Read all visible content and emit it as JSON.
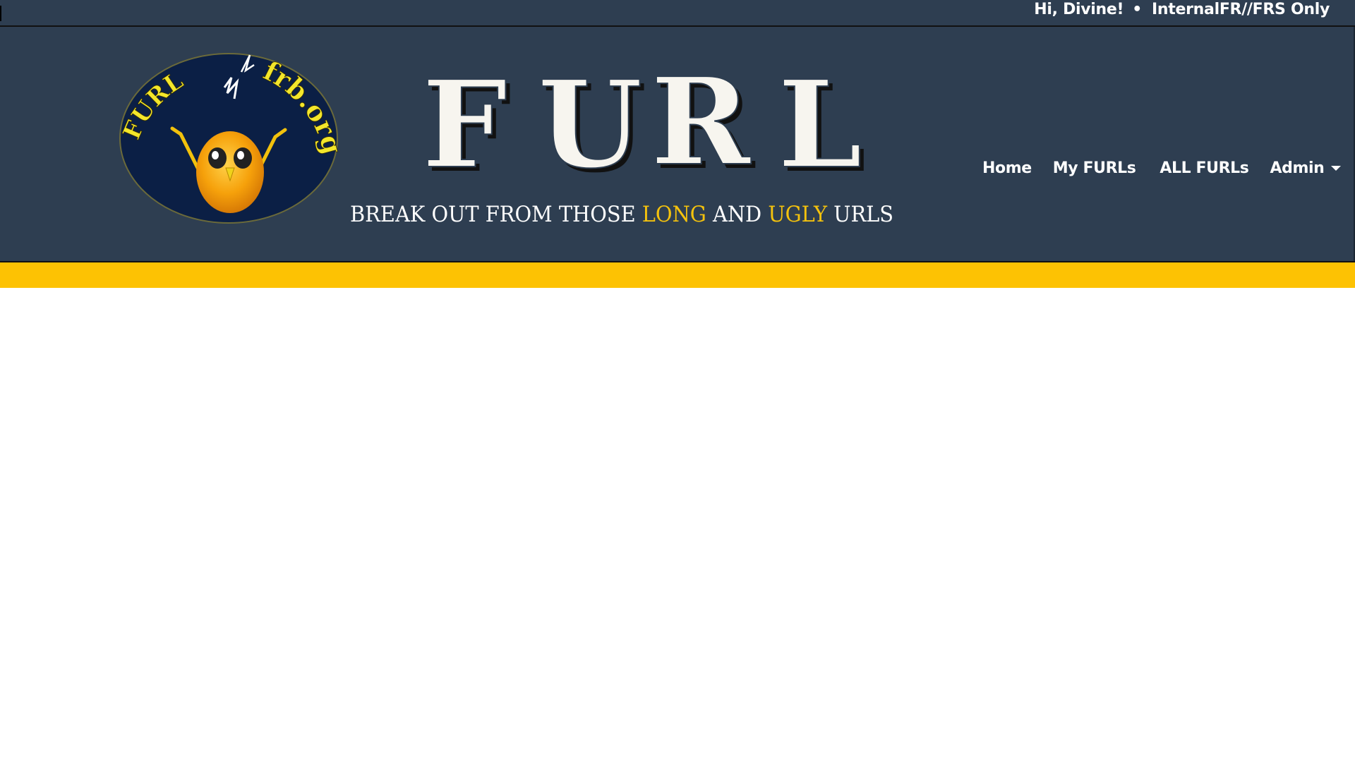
{
  "topbar": {
    "greeting": "Hi, Divine!",
    "separator": "•",
    "classification": "InternalFR//FRS Only"
  },
  "logo": {
    "ring_text_left": "FURL",
    "ring_text_right": "frb.org",
    "icon": "chick-mascot-icon"
  },
  "title": {
    "letters": [
      "F",
      "U",
      "R",
      "L"
    ]
  },
  "tagline": {
    "part1": "BREAK OUT FROM THOSE ",
    "highlight1": "LONG",
    "part2": " AND ",
    "highlight2": "UGLY",
    "part3": " URLS"
  },
  "nav": {
    "home": "Home",
    "my_furls": "My FURLs",
    "all_furls": "ALL FURLs",
    "admin": "Admin"
  },
  "colors": {
    "header_bg": "#2e3e51",
    "accent_yellow": "#fdc203",
    "tagline_highlight": "#f4c20d",
    "logo_bg": "#0b1f45"
  }
}
